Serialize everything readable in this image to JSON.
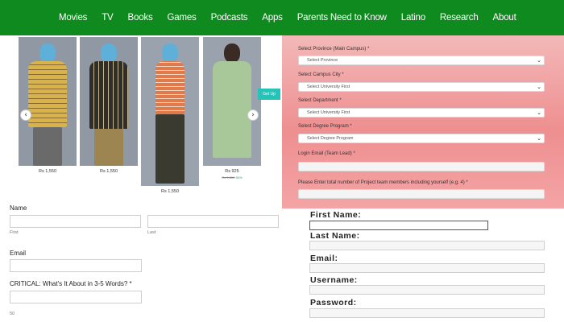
{
  "nav": {
    "items": [
      "Movies",
      "TV",
      "Books",
      "Games",
      "Podcasts",
      "Apps",
      "Parents Need to Know",
      "Latino",
      "Research",
      "About"
    ]
  },
  "colors": {
    "nav_bg": "#0f8a1f",
    "form_pink": "#ee8f90",
    "getup_badge": "#27c3b8"
  },
  "carousel": {
    "prev_label": "‹",
    "next_label": "›",
    "badge": "Get Up",
    "products": [
      {
        "price": "Rs 1,550",
        "shirt": "yellow-check-shirt"
      },
      {
        "price": "Rs 1,550",
        "shirt": "dark-check-shirt"
      },
      {
        "price": "Rs 1,550",
        "shirt": "orange-check-shirt"
      },
      {
        "price": "Rs 925",
        "old_price": "Rs 1,850",
        "discount": "50%",
        "shirt": "sage-shirt"
      }
    ]
  },
  "contact_form": {
    "name_label": "Name",
    "first_hint": "First",
    "last_hint": "Last",
    "email_label": "Email",
    "critical_label": "CRITICAL: What's It About in 3-5 Words? *",
    "count": "50"
  },
  "project_form": {
    "province_label": "Select Province (Main Campus)  *",
    "province_value": "Select Province",
    "city_label": "Select Campus City  *",
    "city_value": "Select University First",
    "department_label": "Select Department  *",
    "department_value": "Select University First",
    "degree_label": "Select Degree Program  *",
    "degree_value": "Select Degree Program",
    "email_label": "Login Email (Team Lead)  *",
    "members_label": "Please Enter total number of Project team members including yourself (e.g. 4)  *"
  },
  "signup_form": {
    "first_name": "First Name:",
    "last_name": "Last Name:",
    "email": "Email:",
    "username": "Username:",
    "password": "Password:"
  }
}
